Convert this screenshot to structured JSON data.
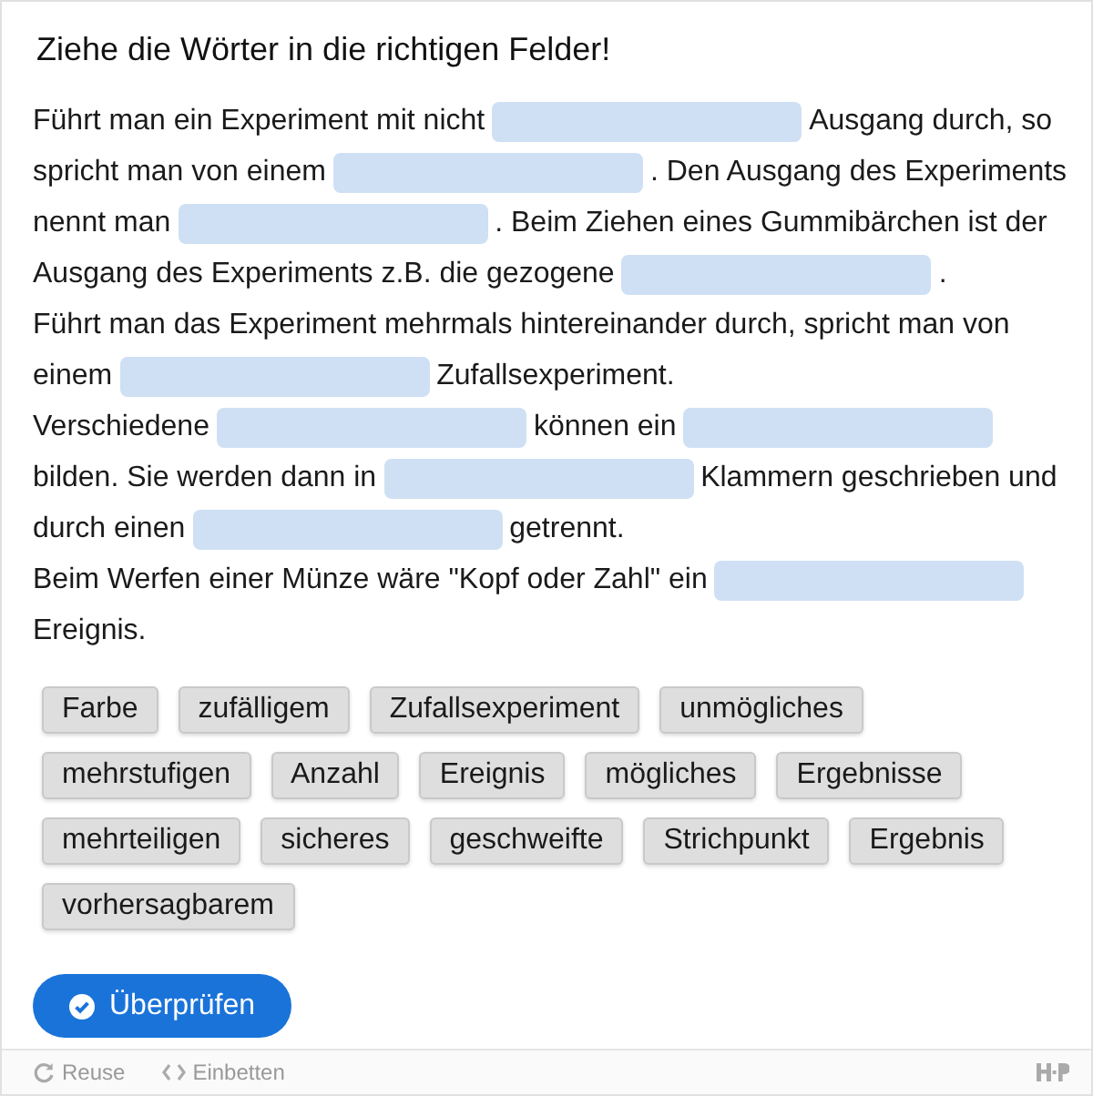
{
  "title": "Ziehe die Wörter in die richtigen Felder!",
  "lines": [
    [
      {
        "kind": "text",
        "text": "Führt man ein Experiment mit nicht"
      },
      {
        "kind": "blank"
      },
      {
        "kind": "text",
        "text": "Ausgang durch, so"
      }
    ],
    [
      {
        "kind": "text",
        "text": "spricht man von einem"
      },
      {
        "kind": "blank"
      },
      {
        "kind": "text",
        "text": ". Den Ausgang des Experiments"
      }
    ],
    [
      {
        "kind": "text",
        "text": "nennt man"
      },
      {
        "kind": "blank"
      },
      {
        "kind": "text",
        "text": ". Beim Ziehen eines Gummibärchen ist der"
      }
    ],
    [
      {
        "kind": "text",
        "text": "Ausgang des Experiments z.B. die gezogene"
      },
      {
        "kind": "blank"
      },
      {
        "kind": "text",
        "text": "."
      }
    ],
    [
      {
        "kind": "text",
        "text": "Führt man das Experiment mehrmals hintereinander durch, spricht man von"
      }
    ],
    [
      {
        "kind": "text",
        "text": "einem"
      },
      {
        "kind": "blank"
      },
      {
        "kind": "text",
        "text": "Zufallsexperiment."
      }
    ],
    [
      {
        "kind": "text",
        "text": "Verschiedene"
      },
      {
        "kind": "blank"
      },
      {
        "kind": "text",
        "text": "können ein"
      },
      {
        "kind": "blank"
      }
    ],
    [
      {
        "kind": "text",
        "text": "bilden. Sie werden dann in"
      },
      {
        "kind": "blank"
      },
      {
        "kind": "text",
        "text": "Klammern geschrieben und"
      }
    ],
    [
      {
        "kind": "text",
        "text": "durch einen"
      },
      {
        "kind": "blank"
      },
      {
        "kind": "text",
        "text": "getrennt."
      }
    ],
    [
      {
        "kind": "text",
        "text": "Beim Werfen einer Münze wäre \"Kopf oder Zahl\" ein"
      },
      {
        "kind": "blank"
      }
    ],
    [
      {
        "kind": "text",
        "text": "Ereignis."
      }
    ]
  ],
  "words": [
    "Farbe",
    "zufälligem",
    "Zufallsexperiment",
    "unmögliches",
    "mehrstufigen",
    "Anzahl",
    "Ereignis",
    "mögliches",
    "Ergebnisse",
    "mehrteiligen",
    "sicheres",
    "geschweifte",
    "Strichpunkt",
    "Ergebnis",
    "vorhersagbarem"
  ],
  "check_button": "Überprüfen",
  "footer": {
    "reuse": "Reuse",
    "embed": "Einbetten"
  }
}
